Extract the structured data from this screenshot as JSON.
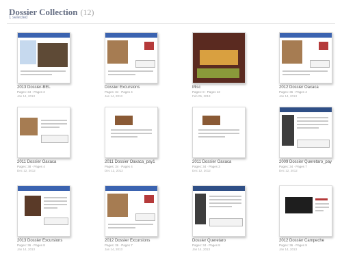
{
  "header": {
    "title": "Dossier Collection",
    "count": "(12)",
    "subtitle": "1 selected"
  },
  "items": [
    {
      "title": "2013 Dossier-BEL",
      "sub": "Pages: 34 · Pages 2",
      "date": "Jan 14, 2013"
    },
    {
      "title": "Dossier Excursions",
      "sub": "Pages: 34 · Pages 4",
      "date": "Jan 14, 2013"
    },
    {
      "title": "Misc",
      "sub": "Pages: 8 · Pages 12",
      "date": "Feb 05, 2013"
    },
    {
      "title": "2012 Dossier Oaxaca",
      "sub": "Pages: 36 · Pages 4",
      "date": "Jan 14, 2013"
    },
    {
      "title": "2011 Dossier Oaxaca",
      "sub": "Pages: 38 · Pages 4",
      "date": "Dec 12, 2012"
    },
    {
      "title": "2011 Dossier Oaxaca_pay1",
      "sub": "Pages: 34 · Pages 4",
      "date": "Dec 12, 2012"
    },
    {
      "title": "2011 Dossier Oaxaca",
      "sub": "Pages: 34 · Pages 3",
      "date": "Dec 12, 2012"
    },
    {
      "title": "2009 Dossier Queretaro_pay",
      "sub": "Pages: 34 · Pages 7",
      "date": "Dec 12, 2012"
    },
    {
      "title": "2013 Dossier Excursions",
      "sub": "Pages: 36 · Pages 8",
      "date": "Jan 14, 2013"
    },
    {
      "title": "2012 Dossier Excursions",
      "sub": "Pages: 36 · Pages 7",
      "date": "Jan 14, 2013"
    },
    {
      "title": "Dossier Queretaro",
      "sub": "Pages: 34 · Pages 8",
      "date": "Jan 14, 2013"
    },
    {
      "title": "2012 Dossier Campeche",
      "sub": "Pages: 36 · Pages 9",
      "date": "Jan 14, 2013"
    }
  ]
}
